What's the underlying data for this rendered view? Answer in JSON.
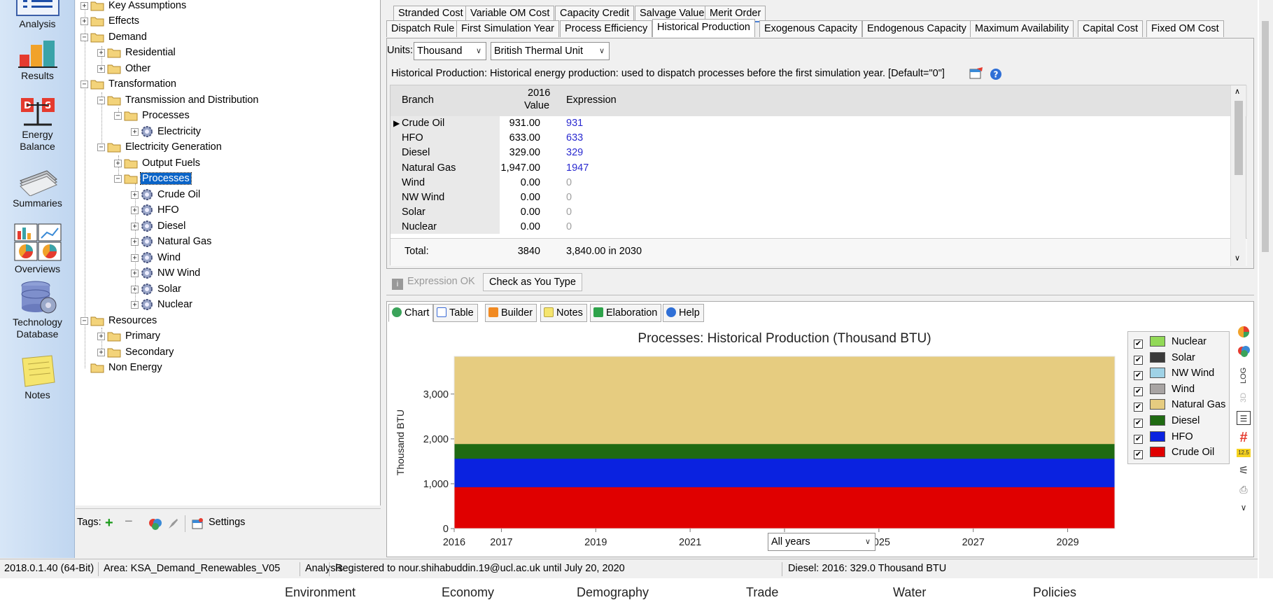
{
  "nav": {
    "items": [
      {
        "label": "Analysis"
      },
      {
        "label": "Results"
      },
      {
        "label": "Energy Balance"
      },
      {
        "label": "Summaries"
      },
      {
        "label": "Overviews"
      },
      {
        "label": "Technology Database"
      },
      {
        "label": "Notes"
      }
    ]
  },
  "tree": {
    "nodes": [
      {
        "label": "Key Assumptions"
      },
      {
        "label": "Effects"
      },
      {
        "label": "Demand"
      },
      {
        "label": "Residential"
      },
      {
        "label": "Other"
      },
      {
        "label": "Transformation"
      },
      {
        "label": "Transmission and Distribution"
      },
      {
        "label": "Processes"
      },
      {
        "label": "Electricity"
      },
      {
        "label": "Electricity Generation"
      },
      {
        "label": "Output Fuels"
      },
      {
        "label": "Processes"
      },
      {
        "label": "Crude Oil"
      },
      {
        "label": "HFO"
      },
      {
        "label": "Diesel"
      },
      {
        "label": "Natural Gas"
      },
      {
        "label": "Wind"
      },
      {
        "label": "NW Wind"
      },
      {
        "label": "Solar"
      },
      {
        "label": "Nuclear"
      },
      {
        "label": "Resources"
      },
      {
        "label": "Primary"
      },
      {
        "label": "Secondary"
      },
      {
        "label": "Non Energy"
      }
    ]
  },
  "tags": {
    "label": "Tags:",
    "settings": "Settings"
  },
  "tabs": {
    "top": [
      "Stranded Cost",
      "Variable OM Cost",
      "Capacity Credit",
      "Salvage Value",
      "Merit Order"
    ],
    "main": [
      "Dispatch Rule",
      "First Simulation Year",
      "Process Efficiency",
      "Historical Production",
      "Exogenous Capacity",
      "Endogenous Capacity",
      "Maximum Availability",
      "Capital Cost",
      "Fixed OM Cost"
    ]
  },
  "units": {
    "label": "Units:",
    "scale": "Thousand",
    "unit": "British Thermal Unit"
  },
  "description": "Historical Production: Historical energy production: used to dispatch processes before the first simulation year. [Default=\"0\"]",
  "grid": {
    "col_branch": "Branch",
    "col_year": "2016",
    "col_value": "Value",
    "col_expression": "Expression",
    "rows": [
      {
        "branch": "Crude Oil",
        "value": "931.00",
        "expr": "931"
      },
      {
        "branch": "HFO",
        "value": "633.00",
        "expr": "633"
      },
      {
        "branch": "Diesel",
        "value": "329.00",
        "expr": "329"
      },
      {
        "branch": "Natural Gas",
        "value": "1,947.00",
        "expr": "1947"
      },
      {
        "branch": "Wind",
        "value": "0.00",
        "expr": "0"
      },
      {
        "branch": "NW Wind",
        "value": "0.00",
        "expr": "0"
      },
      {
        "branch": "Solar",
        "value": "0.00",
        "expr": "0"
      },
      {
        "branch": "Nuclear",
        "value": "0.00",
        "expr": "0"
      }
    ],
    "total_label": "Total:",
    "total_value": "3840",
    "total_expr": "3,840.00 in 2030"
  },
  "check": {
    "expression_ok": "Expression OK",
    "check_as_you_type": "Check as You Type"
  },
  "chart_tabs": [
    "Chart",
    "Table",
    "Builder",
    "Notes",
    "Elaboration",
    "Help"
  ],
  "year_select": "All years",
  "chart_data": {
    "type": "area",
    "title": "Processes: Historical Production (Thousand BTU)",
    "xlabel": "",
    "ylabel": "Thousand BTU",
    "x": [
      2016,
      2030
    ],
    "xticks": [
      "2016",
      "2017",
      "2019",
      "2021",
      "2023",
      "2025",
      "2027",
      "2029"
    ],
    "xlim": [
      2016,
      2030
    ],
    "ylim": [
      0,
      3840
    ],
    "yticks": [
      "0",
      "1,000",
      "2,000",
      "3,000"
    ],
    "grid": false,
    "legend_position": "right",
    "series": [
      {
        "name": "Crude Oil",
        "values": [
          931,
          931
        ],
        "color": "#e00000"
      },
      {
        "name": "HFO",
        "values": [
          633,
          633
        ],
        "color": "#0a22e0"
      },
      {
        "name": "Diesel",
        "values": [
          329,
          329
        ],
        "color": "#1f6a12"
      },
      {
        "name": "Natural Gas",
        "values": [
          1947,
          1947
        ],
        "color": "#e6cc80"
      },
      {
        "name": "Wind",
        "values": [
          0,
          0
        ],
        "color": "#a8a4a3"
      },
      {
        "name": "NW Wind",
        "values": [
          0,
          0
        ],
        "color": "#9fd2e6"
      },
      {
        "name": "Solar",
        "values": [
          0,
          0
        ],
        "color": "#3a3a3a"
      },
      {
        "name": "Nuclear",
        "values": [
          0,
          0
        ],
        "color": "#92d957"
      }
    ],
    "legend_order": [
      "Nuclear",
      "Solar",
      "NW Wind",
      "Wind",
      "Natural Gas",
      "Diesel",
      "HFO",
      "Crude Oil"
    ]
  },
  "right_tools": {
    "log": "LOG",
    "three_d": "3D",
    "decimals": "12.5"
  },
  "status": {
    "version": "2018.0.1.40 (64-Bit)",
    "area": "Area: KSA_Demand_Renewables_V05",
    "view": "Analysis",
    "registration": "Registered to nour.shihabuddin.19@ucl.ac.uk until July 20, 2020",
    "info": "Diesel: 2016: 329.0 Thousand BTU"
  },
  "bottom_strip": [
    "Environment",
    "Economy",
    "Demography",
    "Trade",
    "Water",
    "Policies"
  ]
}
